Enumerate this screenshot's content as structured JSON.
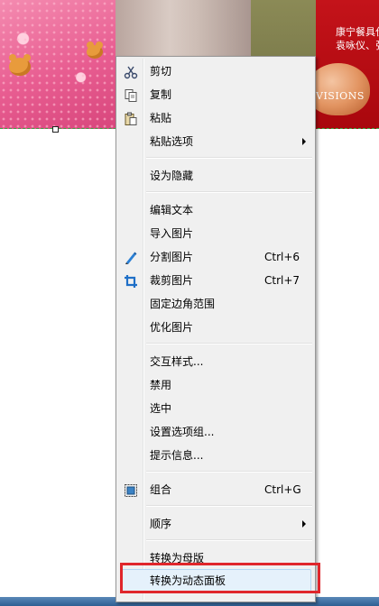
{
  "banner": {
    "red_text": "康宁餐具仕\n袁咏仪、张",
    "visions": "VISIONS"
  },
  "menu": {
    "items": [
      {
        "label": "剪切",
        "icon": "scissors-icon"
      },
      {
        "label": "复制",
        "icon": "copy-icon"
      },
      {
        "label": "粘贴",
        "icon": "paste-icon"
      },
      {
        "label": "粘贴选项",
        "submenu": true
      },
      {
        "label": "设为隐藏"
      },
      {
        "label": "编辑文本"
      },
      {
        "label": "导入图片"
      },
      {
        "label": "分割图片",
        "shortcut": "Ctrl+6",
        "icon": "slice-pen-icon"
      },
      {
        "label": "裁剪图片",
        "shortcut": "Ctrl+7",
        "icon": "crop-icon"
      },
      {
        "label": "固定边角范围"
      },
      {
        "label": "优化图片"
      },
      {
        "label": "交互样式..."
      },
      {
        "label": "禁用"
      },
      {
        "label": "选中"
      },
      {
        "label": "设置选项组..."
      },
      {
        "label": "提示信息..."
      },
      {
        "label": "组合",
        "shortcut": "Ctrl+G",
        "icon": "group-icon"
      },
      {
        "label": "顺序",
        "submenu": true
      },
      {
        "label": "转换为母版"
      },
      {
        "label": "转换为动态面板",
        "highlighted": true
      }
    ]
  },
  "colors": {
    "highlight_box": "#e0262b",
    "hover_fill": "#e5f1fb"
  }
}
